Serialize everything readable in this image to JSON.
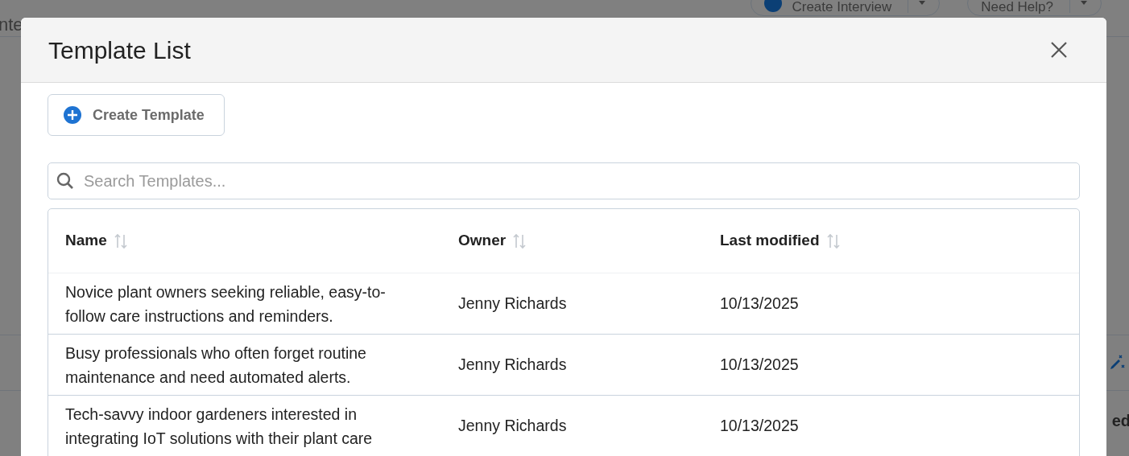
{
  "background": {
    "nav_fragment": "nte",
    "header_buttons": [
      {
        "label": "Create Interview",
        "kind": "primary"
      },
      {
        "label": "Need Help?",
        "kind": "plain"
      }
    ],
    "column_fragment": "ed"
  },
  "modal": {
    "title": "Template List",
    "create_button": "Create Template",
    "search": {
      "placeholder": "Search Templates..."
    },
    "table": {
      "columns": [
        "Name",
        "Owner",
        "Last modified"
      ],
      "rows": [
        {
          "name": "Novice plant owners seeking reliable, easy-to-follow care instructions and reminders.",
          "owner": "Jenny Richards",
          "modified": "10/13/2025"
        },
        {
          "name": "Busy professionals who often forget routine maintenance and need automated alerts.",
          "owner": "Jenny Richards",
          "modified": "10/13/2025"
        },
        {
          "name": "Tech-savvy indoor gardeners interested in integrating IoT solutions with their plant care",
          "owner": "Jenny Richards",
          "modified": "10/13/2025"
        }
      ]
    }
  }
}
